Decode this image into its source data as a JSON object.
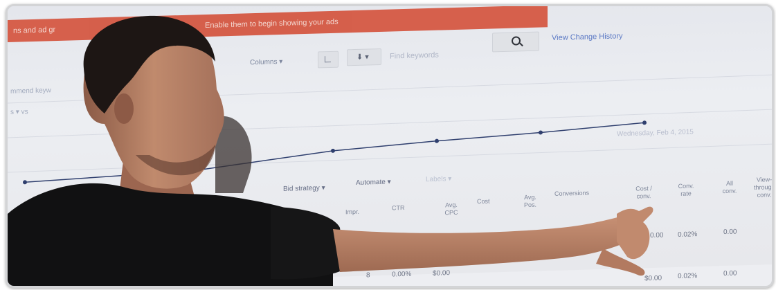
{
  "screen": {
    "alert_left": "ns and ad gr",
    "alert_right": "Enable them to begin showing your ads",
    "columns_label": "Columns ▾",
    "search_placeholder": "Find keywords",
    "view_change_history": "View Change History",
    "left_text_1": "mmend keyw",
    "left_text_2": "s ▾   vs",
    "chart_caption": "Wednesday, Feb 4, 2015",
    "bid_strategy": "Bid strategy ▾",
    "automate": "Automate ▾",
    "labels": "Labels ▾",
    "headers": [
      "Impr.",
      "CTR",
      "Avg. CPC",
      "Cost",
      "Avg. Pos.",
      "Conversions",
      "Cost / conv.",
      "Conv. rate",
      "All conv.",
      "View-through conv."
    ],
    "row1": {
      "cost_conv": "0.00",
      "conv_rate": "0.02%",
      "all_conv": "0.00"
    },
    "row2": {
      "impr": "8",
      "ctr": "0.00%",
      "cpc": "$0.00",
      "cost_conv": "$0.00",
      "conv_rate": "0.02%",
      "all_conv": "0.00"
    }
  },
  "colors": {
    "alert": "#d4513a",
    "link": "#5a78c4",
    "chart_line": "#2f3f6e",
    "shirt": "#101012",
    "skin": "#b77a5e",
    "frame_border": "#d3d4d6"
  }
}
